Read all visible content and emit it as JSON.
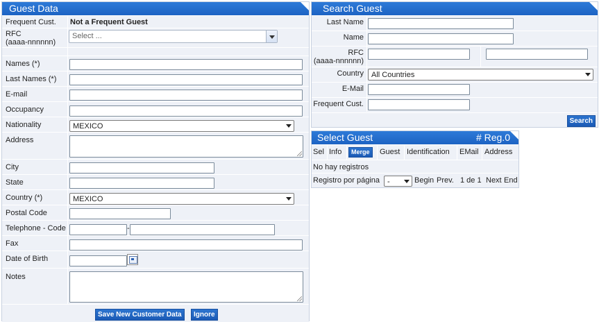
{
  "guest_data": {
    "title": "Guest Data",
    "frequent_label": "Frequent Cust.",
    "frequent_value": "Not a Frequent Guest",
    "rfc_label_line1": "RFC",
    "rfc_label_line2": "(aaaa-nnnnnn)",
    "rfc_select_placeholder": "Select ...",
    "names_label": "Names (*)",
    "last_names_label": "Last Names (*)",
    "email_label": "E-mail",
    "occupancy_label": "Occupancy",
    "nationality_label": "Nationality",
    "nationality_value": "MEXICO",
    "address_label": "Address",
    "city_label": "City",
    "state_label": "State",
    "country_label": "Country (*)",
    "country_value": "MEXICO",
    "postal_label": "Postal Code",
    "telephone_label": "Telephone - Code",
    "telephone_sep": "-",
    "fax_label": "Fax",
    "dob_label": "Date of Birth",
    "notes_label": "Notes",
    "save_button": "Save New Customer Data",
    "ignore_button": "Ignore"
  },
  "search_guest": {
    "title": "Search Guest",
    "last_name_label": "Last Name",
    "name_label": "Name",
    "rfc_label_line1": "RFC",
    "rfc_label_line2": "(aaaa-nnnnnn)",
    "country_label": "Country",
    "country_value": "All Countries",
    "email_label": "E-Mail",
    "frequent_label": "Frequent Cust.",
    "search_button": "Search"
  },
  "select_guest": {
    "title": "Select Guest",
    "reg_count": "# Reg.0",
    "columns": [
      "Sel",
      "Info",
      "Merge",
      "Guest",
      "Identification",
      "EMail",
      "Address"
    ],
    "empty_message": "No hay registros",
    "per_page_label": "Registro por página",
    "per_page_value": "-",
    "begin": "Begin",
    "prev": "Prev.",
    "page_info": "1 de 1",
    "next": "Next",
    "end": "End"
  }
}
